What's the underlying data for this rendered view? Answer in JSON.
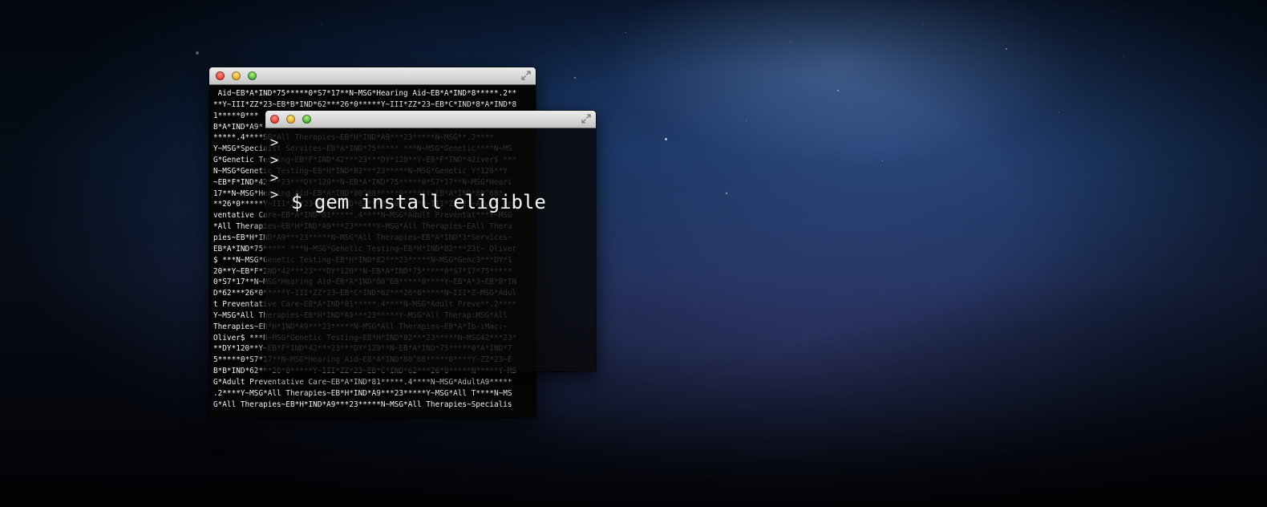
{
  "back_terminal": {
    "lines": [
      " Aid~EB*A*IND*75*****0*S7*17**N~MSG*Hearing Aid~EB*A*IND*8*****.2**",
      "**Y~III*ZZ*23~EB*B*IND*62***26*0*****Y~III*ZZ*23~EB*C*IND*8*A*IND*8",
      "1*****0***",
      "B*A*IND*A9*",
      "*****.4****SG*All Therapies~EB*H*IND*A9***23*****N~MSG**.2****",
      "Y~MSG*Speciaist Services~EB*A*IND*75***** ***N~MSG*Genetic****N~MS",
      "G*Genetic Testing~EB*F*IND*42***23***DY*120**Y~EB*F*IND*42iver$ ***",
      "N~MSG*Genetic Testing~EB*H*IND*82***23*****N~MSG*Genetic Y*120**Y",
      "~EB*F*IND*42***23***DY*120**N~EB*A*IND*75*****0*S7*17**N~MSG*Heari",
      "17**N~MSG*Hearing Aid~EB*A*IND*80^68*****0*****Y~EB*A*IND*80^68*",
      "**26*0*****Y~III*ZZ*23~EB*C*IND*62***26*0*****N~III*ZZ*23~Adult Pre",
      "ventative Care~EB*A*IND*81*****.4****N~MSG*Adult Preventat***Y~MSG",
      "*All Therapies~EB*H*IND*A9***23*****Y~MSG*All Therapies~EAll Thera",
      "pies~EB*H*IND*A9***23*****N~MSG*All Therapies~EB*A*IND*3*Services~",
      "EB*A*IND*75***** ***N~MSG*Genetic Testing~EB*H*IND*82***23t~ Oliver",
      "$ ***N~MSG*Genetic Testing~EB*H*IND*82***23*****N~MSG*Genc3***DY*1",
      "20**Y~EB*F*IND*42***23***DY*120**N~EB*A*IND*75*****0*S7*17*75*****",
      "0*S7*17**N~MSG*Hearing Aid~EB*A*IND*80^68*****0****Y~EB*A*3~EB*B*IN",
      "D*62***26*0*****Y~III*ZZ*23~EB*C*IND*62***26*0*****N~III*Z~MSG*Adul",
      "t Preventative Care~EB*A*IND*81*****.4****N~MSG*Adult Preve**.2****",
      "Y~MSG*All Therapies~EB*H*IND*A9***23*****Y~MSG*All Therap:MSG*All",
      "Therapies~EB*H*IND*A9***23*****N~MSG*All Therapies~EB*A*Ib-iMac:~",
      "Oliver$ ***N~MSG*Genetic Testing~EB*H*IND*82***23*****N~MSG42***23*",
      "**DY*120**Y~EB*F*IND*42***23***DY*120**N~EB*A*IND*75*****0*A*IND*7",
      "5*****0*S7*17**N~MSG*Hearing Aid~EB*A*IND*80^68*****0****Y~ZZ*23~E",
      "B*B*IND*62***26*0*****Y~III*ZZ*23~EB*C*IND*62***26*0*****N*****Y~MS",
      "G*Adult Preventative Care~EB*A*IND*81*****.4****N~MSG*AdultA9*****",
      ".2****Y~MSG*All Therapies~EB*H*IND*A9***23*****Y~MSG*All T****N~MS",
      "G*All Therapies~EB*H*IND*A9***23*****N~MSG*All Therapies~Specialis"
    ]
  },
  "front_terminal": {
    "prompts": [
      ">",
      ">",
      ">",
      ">"
    ],
    "command": "$ gem install eligible"
  }
}
